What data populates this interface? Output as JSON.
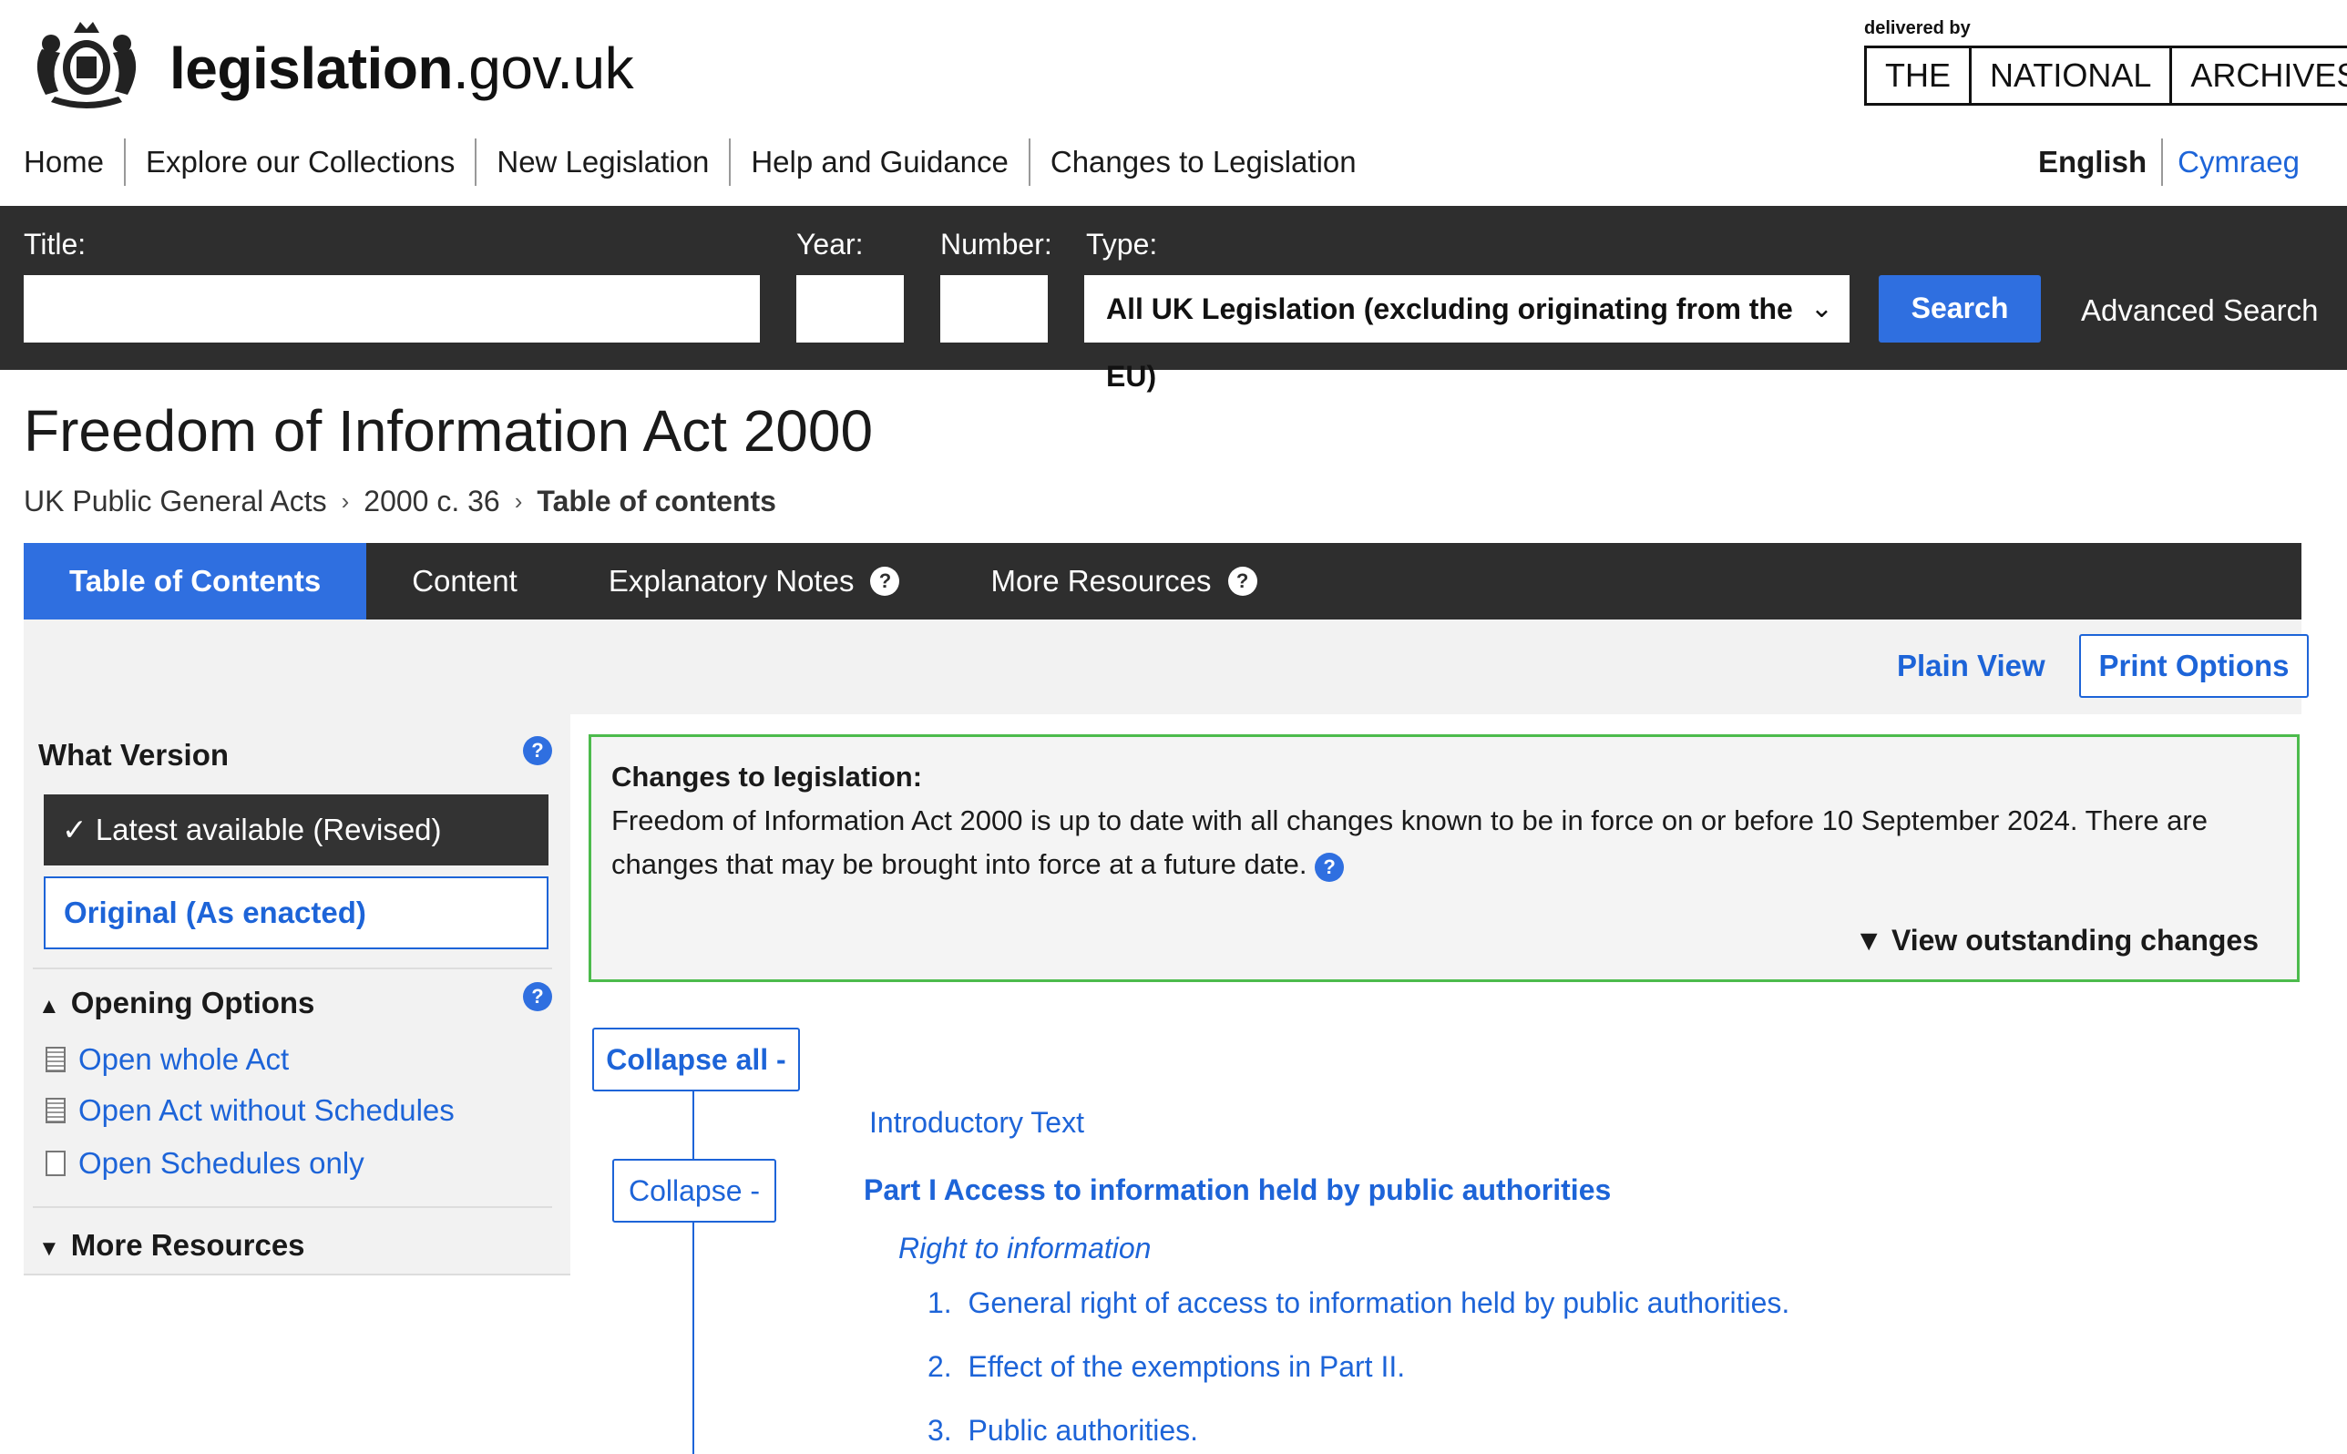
{
  "header": {
    "site_name_bold": "legislation",
    "site_name_rest": ".gov.uk",
    "delivered_by": "delivered by",
    "tna": [
      "THE",
      "NATIONAL",
      "ARCHIVES"
    ]
  },
  "nav": {
    "items": [
      "Home",
      "Explore our Collections",
      "New Legislation",
      "Help and Guidance",
      "Changes to Legislation"
    ],
    "lang_en": "English",
    "lang_cy": "Cymraeg"
  },
  "search": {
    "title_label": "Title:",
    "year_label": "Year:",
    "number_label": "Number:",
    "type_label": "Type:",
    "type_value": "All UK Legislation (excluding originating from the EU)",
    "search_button": "Search",
    "advanced": "Advanced Search"
  },
  "page": {
    "title": "Freedom of Information Act 2000",
    "breadcrumb": [
      "UK Public General Acts",
      "2000 c. 36",
      "Table of contents"
    ]
  },
  "tabs": [
    "Table of Contents",
    "Content",
    "Explanatory Notes",
    "More Resources"
  ],
  "toolbar": {
    "plain_view": "Plain View",
    "print_options": "Print Options"
  },
  "sidebar": {
    "what_version": "What Version",
    "latest": "Latest available (Revised)",
    "original": "Original (As enacted)",
    "opening_options": "Opening Options",
    "open_whole": "Open whole Act",
    "open_without": "Open Act without Schedules",
    "open_schedules": "Open Schedules only",
    "more_resources": "More Resources",
    "help": "?"
  },
  "changes": {
    "heading": "Changes to legislation:",
    "line1": "Freedom of Information Act 2000 is up to date with all changes known to be in force on or before 10 September 2024. There are",
    "line2": "changes that may be brought into force at a future date.",
    "outstanding": "View outstanding changes"
  },
  "toc": {
    "collapse_all": "Collapse all -",
    "collapse": "Collapse -",
    "intro": "Introductory Text",
    "part1": "Part I Access to information held by public authorities",
    "crossheading": "Right to information",
    "items": [
      {
        "num": "1.",
        "text": "General right of access to information held by public authorities."
      },
      {
        "num": "2.",
        "text": "Effect of the exemptions in Part II."
      },
      {
        "num": "3.",
        "text": "Public authorities."
      }
    ]
  }
}
